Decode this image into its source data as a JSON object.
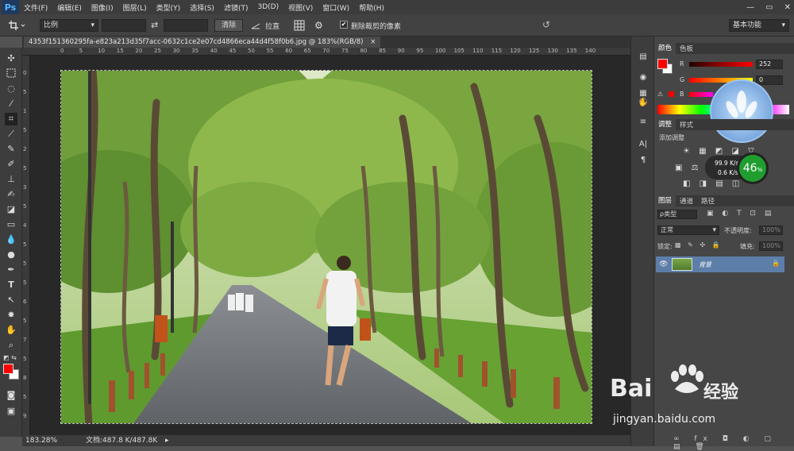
{
  "app": {
    "logo": "Ps"
  },
  "menu": [
    "文件(F)",
    "编辑(E)",
    "图像(I)",
    "图层(L)",
    "类型(Y)",
    "选择(S)",
    "滤镜(T)",
    "3D(D)",
    "视图(V)",
    "窗口(W)",
    "帮助(H)"
  ],
  "window_controls": {
    "minimize": "—",
    "restore": "▭",
    "close": "✕"
  },
  "options": {
    "crop_icon": "crop-icon",
    "ratio_select": "比例",
    "swap_icon": "⇄",
    "clear_button": "清除",
    "straighten_label": "拉直",
    "delete_cropped_checked": "✔",
    "delete_cropped_label": "删除裁剪的像素",
    "workspace_select": "基本功能"
  },
  "document": {
    "tab_title": "4353f151360295fa-e823a213d35f7acc-0632c1ce2e07cd4866eca44d4f58f0b6.jpg @ 183%(RGB/8)",
    "close_glyph": "×"
  },
  "ruler_top_ticks": [
    "0",
    "5",
    "10",
    "15",
    "20",
    "25",
    "30",
    "35",
    "40",
    "45",
    "50",
    "55",
    "60",
    "65",
    "70",
    "75",
    "80",
    "85",
    "90",
    "95",
    "100",
    "105",
    "110",
    "115",
    "120",
    "125",
    "130",
    "135",
    "140"
  ],
  "ruler_left_ticks": [
    "0",
    "5",
    "1",
    "5",
    "2",
    "5",
    "3",
    "5",
    "4",
    "5",
    "5",
    "5",
    "6",
    "5",
    "7",
    "5",
    "8",
    "5",
    "9"
  ],
  "status": {
    "zoom": "183.28%",
    "doc_size": "文档:487.8 K/487.8K"
  },
  "color_panel": {
    "tabs": [
      "颜色",
      "色板"
    ],
    "channels": [
      {
        "label": "R",
        "value": "252"
      },
      {
        "label": "G",
        "value": "0"
      },
      {
        "label": "B",
        "value": ""
      }
    ],
    "foreground_color": "#fc0000"
  },
  "adjust_panel": {
    "tabs": [
      "调整",
      "样式"
    ],
    "title": "添加调整"
  },
  "net_widget": {
    "upload": "99.9 K/s",
    "download": "0.6 K/s",
    "percent": "46",
    "percent_sign": "%"
  },
  "layers_panel": {
    "tabs": [
      "图层",
      "通道",
      "路径"
    ],
    "filter_select": "ρ类型",
    "blend_mode": "正常",
    "opacity_label": "不透明度:",
    "opacity_value": "100%",
    "lock_label": "锁定:",
    "fill_label": "填充:",
    "fill_value": "100%",
    "layers": [
      {
        "name": "背景",
        "locked": true
      }
    ]
  },
  "watermark": {
    "brand": "Bai",
    "brand_suffix": "经验",
    "url": "jingyan.baidu.com"
  }
}
